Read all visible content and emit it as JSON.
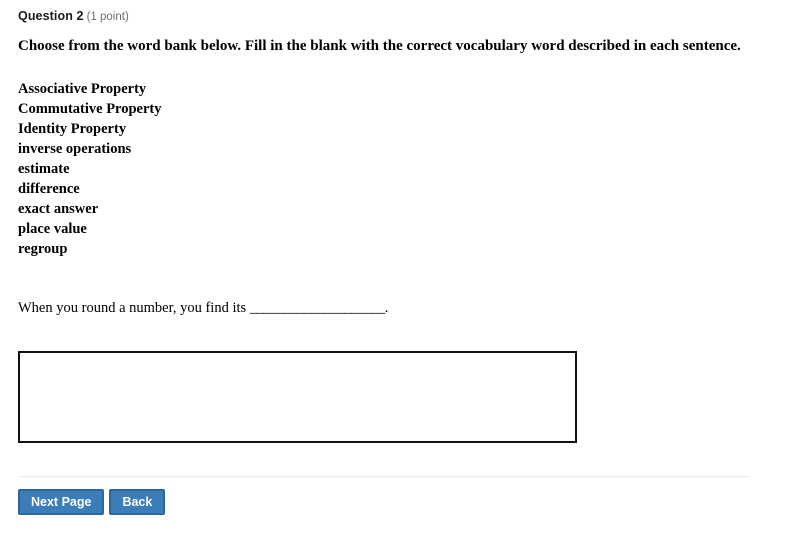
{
  "question": {
    "label": "Question 2",
    "points": "(1 point)"
  },
  "instruction": "Choose from the word bank below. Fill in the blank with the correct vocabulary word described in each sentence.",
  "word_bank": [
    "Associative Property",
    "Commutative Property",
    "Identity Property",
    "inverse operations",
    "estimate",
    "difference",
    "exact answer",
    "place value",
    "regroup"
  ],
  "sentence": {
    "before_blank": "When you round a number, you find its ",
    "blank": "____________________",
    "after_blank": "."
  },
  "answer_field": {
    "value": "",
    "placeholder": ""
  },
  "buttons": {
    "next": "Next Page",
    "back": "Back"
  },
  "colors": {
    "button_fill": "#3b7db9",
    "button_border": "#2d679d",
    "button_text": "#ffffff",
    "points_text": "#6d6d6d",
    "divider": "#ededed",
    "textarea_border": "#111111",
    "page_background": "#ffffff"
  }
}
